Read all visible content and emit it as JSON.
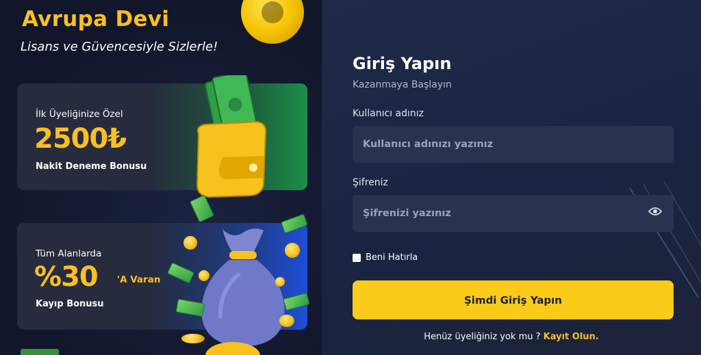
{
  "promo": {
    "title": "Avrupa Devi",
    "subtitle": "Lisans ve Güvencesiyle Sizlerle!",
    "card1": {
      "small": "İlk Üyeliğinize Özel",
      "big": "2500₺",
      "foot": "Nakit Deneme Bonusu"
    },
    "card2": {
      "small": "Tüm Alanlarda",
      "big": "%30",
      "suffix": "'A Varan",
      "foot": "Kayıp Bonusu"
    }
  },
  "login": {
    "title": "Giriş Yapın",
    "subtitle": "Kazanmaya Başlayın",
    "username_label": "Kullanıcı adınız",
    "username_placeholder": "Kullanıcı adınızı yazınız",
    "password_label": "Şifreniz",
    "password_placeholder": "Şifrenizi yazınız",
    "remember_label": "Beni Hatırla",
    "submit_label": "Şimdi Giriş Yapın",
    "signup_text": "Henüz üyeliğiniz yok mu ?",
    "signup_link": "Kayıt Olun."
  },
  "icons": {
    "eye": "eye-icon",
    "wallet": "wallet-illustration",
    "money_bag": "money-bag-illustration"
  },
  "colors": {
    "accent": "#fbbf24",
    "button": "#fbcb1a",
    "panel": "#1e2a47",
    "input": "#2a334e"
  }
}
